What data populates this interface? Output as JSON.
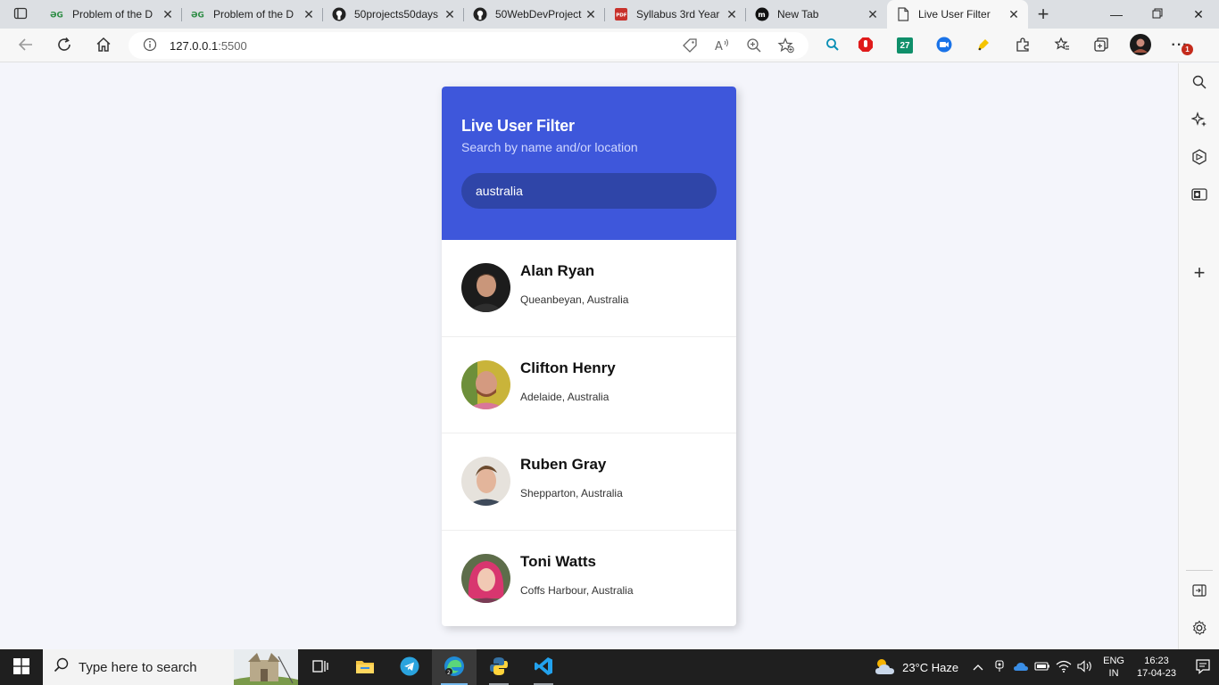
{
  "browser": {
    "tabs": [
      {
        "title": "Problem of the D",
        "icon": "geeksforgeeks-icon",
        "active": false
      },
      {
        "title": "Problem of the D",
        "icon": "geeksforgeeks-icon",
        "active": false
      },
      {
        "title": "50projects50days",
        "icon": "github-icon",
        "active": false
      },
      {
        "title": "50WebDevProject",
        "icon": "github-icon",
        "active": false
      },
      {
        "title": "Syllabus 3rd Year",
        "icon": "pdf-icon",
        "active": false
      },
      {
        "title": "New Tab",
        "icon": "medium-icon",
        "active": false
      },
      {
        "title": "Live User Filter",
        "icon": "page-icon",
        "active": true
      }
    ],
    "address": {
      "host": "127.0.0.1",
      "port": ":5500"
    },
    "extension_badges": {
      "calendar": "27",
      "notifications": "1"
    }
  },
  "app": {
    "title": "Live User Filter",
    "subtitle": "Search by name and/or location",
    "filter_value": "australia",
    "users": [
      {
        "name": "Alan Ryan",
        "location": "Queanbeyan, Australia"
      },
      {
        "name": "Clifton Henry",
        "location": "Adelaide, Australia"
      },
      {
        "name": "Ruben Gray",
        "location": "Shepparton, Australia"
      },
      {
        "name": "Toni Watts",
        "location": "Coffs Harbour, Australia"
      }
    ]
  },
  "taskbar": {
    "search_placeholder": "Type here to search",
    "weather": "23°C  Haze",
    "lang_line1": "ENG",
    "lang_line2": "IN",
    "time": "16:23",
    "date": "17-04-23"
  },
  "colors": {
    "header_bg": "#3e57db",
    "filter_bg": "#2f45a8",
    "page_bg": "#f4f5fb",
    "taskbar_bg": "#1f1f1f"
  }
}
